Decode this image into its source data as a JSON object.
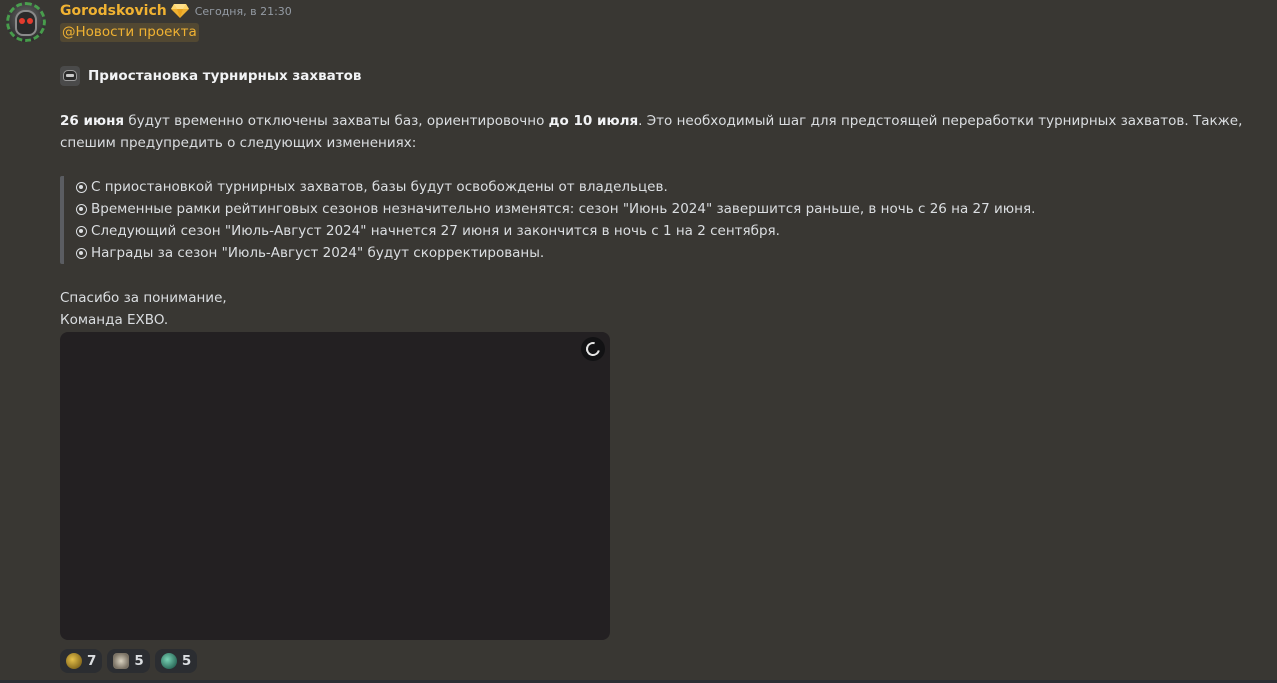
{
  "message": {
    "author": "Gorodskovich",
    "timestamp": "Сегодня, в 21:30",
    "role_mention": "@Новости проекта",
    "heading": "Приостановка турнирных захватов",
    "paragraph": {
      "bold_date": "26 июня",
      "text_1": " будут временно отключены захваты баз, ориентировочно ",
      "bold_until": "до 10 июля",
      "text_2": ". Это необходимый шаг для предстоящей переработки турнирных захватов. Также, спешим предупредить о следующих изменениях:"
    },
    "quote_items": [
      "С приостановкой турнирных захватов, базы будут освобождены от владельцев.",
      "Временные рамки рейтинговых сезонов незначительно изменятся: сезон \"Июнь 2024\" завершится раньше, в ночь с 26 на 27 июня.",
      "Следующий сезон \"Июль-Август 2024\" начнется 27 июня и закончится в ночь с 1 на 2 сентября.",
      "Награды за сезон \"Июль-Август 2024\" будут скорректированы."
    ],
    "signoff_line_1": "Спасибо за понимание,",
    "signoff_line_2": "Команда EXBO."
  },
  "icons": {
    "author_badge": "gem-icon",
    "heading": "helmet-icon",
    "bullet": "radio-bullet-icon",
    "attachment_loading": "loading-spinner-icon"
  },
  "reactions": [
    {
      "icon": "yellow-helmet-emoji",
      "count": "7"
    },
    {
      "icon": "handshake-emoji",
      "count": "5"
    },
    {
      "icon": "green-helmet-emoji",
      "count": "5"
    }
  ],
  "colors": {
    "background": "#393733",
    "username": "#f0b232",
    "mention_text": "#f0b232",
    "text": "#dbdee1",
    "timestamp": "#949ba4",
    "attachment_bg": "#232022",
    "reaction_bg": "#2b2d31"
  }
}
